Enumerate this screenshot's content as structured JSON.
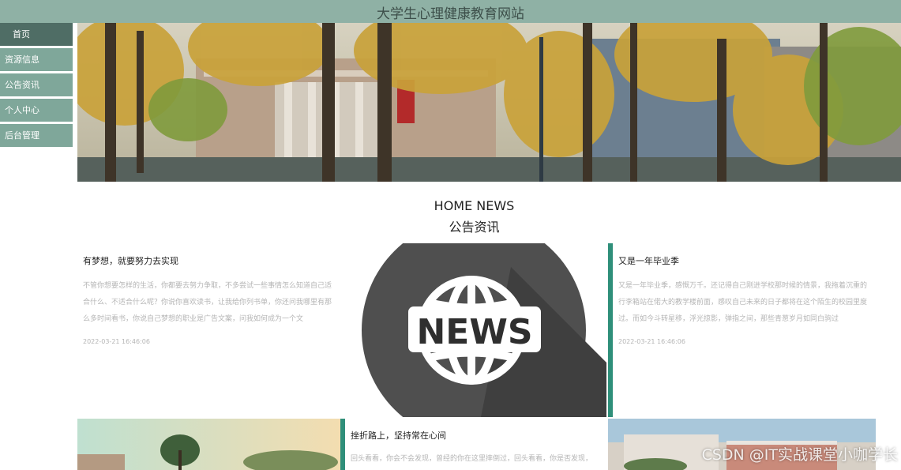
{
  "header": {
    "title": "大学生心理健康教育网站"
  },
  "sidebar": {
    "items": [
      {
        "label": "首页"
      },
      {
        "label": "资源信息"
      },
      {
        "label": "公告资讯"
      },
      {
        "label": "个人中心"
      },
      {
        "label": "后台管理"
      }
    ]
  },
  "section": {
    "title_en": "HOME NEWS",
    "title_cn": "公告资讯"
  },
  "news": [
    {
      "title": "有梦想，就要努力去实现",
      "desc": "不管你想要怎样的生活，你都要去努力争取，不多尝试一些事情怎么知道自己适合什么、不适合什么呢？你说你喜欢读书，让我给你列书单，你还问我哪里有那么多时间看书，你说自己梦想的职业是广告文案，问我如何成为一个文",
      "date": "2022-03-21 16:46:06"
    },
    {
      "title": "又是一年毕业季",
      "desc": "又是一年毕业季，感慨万千。还记得自己刚进学校那时候的情景，我拖着沉重的行李箱站在偌大的教学楼前面，感叹自己未来的日子都将在这个陌生的校园里度过。而如今斗转星移，浮光掠影，弹指之间，那些青葱岁月如同白驹过",
      "date": "2022-03-21 16:46:06"
    },
    {
      "title": "挫折路上，坚持常在心间",
      "desc": "回头看看，你会不会发现，曾经的你在这里摔倒过，回头看看，你是否发现，",
      "date": ""
    }
  ],
  "news_image": {
    "label": "NEWS"
  },
  "watermark": "CSDN @IT实战课堂小咖学长"
}
